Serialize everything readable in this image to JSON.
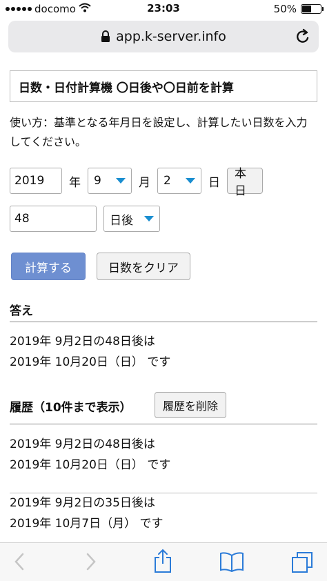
{
  "status": {
    "carrier": "docomo",
    "time": "23:03",
    "battery_text": "50%",
    "battery_level": 0.5
  },
  "browser": {
    "url": "app.k-server.info",
    "lock_icon": "lock-icon",
    "reload_icon": "reload-icon"
  },
  "page": {
    "title": "日数・日付計算機 〇日後や〇日前を計算",
    "instructions": "使い方：基準となる年月日を設定し、計算したい日数を入力してください。",
    "year_value": "2019",
    "year_unit": "年",
    "month_value": "9",
    "month_unit": "月",
    "day_value": "2",
    "day_unit": "日",
    "today_button": "本日",
    "days_value": "48",
    "direction_value": "日後",
    "calc_button": "計算する",
    "clear_button": "日数をクリア",
    "answer_heading": "答え",
    "answer_line1": "2019年 9月2日の48日後は",
    "answer_line2": "2019年 10月20日（日） です",
    "history_heading": "履歴（10件まで表示）",
    "history_delete_button": "履歴を削除",
    "history": [
      {
        "line1": "2019年 9月2日の48日後は",
        "line2": "2019年 10月20日（日） です"
      },
      {
        "line1": "2019年 9月2日の35日後は",
        "line2": "2019年 10月7日（月） です"
      }
    ]
  },
  "colors": {
    "accent": "#1a8ed0",
    "primary_button": "#6e8fd1",
    "toolbar_icon": "#2b7bd8",
    "toolbar_disabled": "#c5c5c5"
  }
}
